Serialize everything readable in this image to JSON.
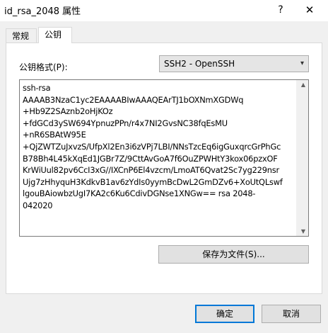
{
  "window": {
    "title": "id_rsa_2048 属性",
    "help_glyph": "?",
    "close_glyph": "✕"
  },
  "tabs": [
    {
      "label": "常规",
      "active": false
    },
    {
      "label": "公钥",
      "active": true
    }
  ],
  "format": {
    "label": "公钥格式(P):",
    "selected": "SSH2 - OpenSSH"
  },
  "key_text": "ssh-rsa\nAAAAB3NzaC1yc2EAAAABIwAAAQEArTJ1bOXNmXGDWq\n+Hb9Z2SAznb2oHjKOz\n+fdGCd3ySW694YpnuzPPn/r4x7NI2GvsNC38fqEsMU\n+nR6SBAtW95E\n+QjZWTZuJxvzS/UfpXl2En3i6zVPj7LBI/NNsTzcEq6igGuxqrcGrPhGc\nB78Bh4L45kXqEd1JGBr7Z/9CttAvGoA7f6OuZPWHtY3kox06pzxOF\nKrWiUul82pv6CcI3xG//IXCnP6El4vzcm/LmoAT6Qvat2Sc7yg229nsr\nUjg7zHhyquH3KdkvB1av6zYdIs0yymBcDwL2GmDZv6+XoUtQLswf\nlgouBAiowbzUgI7KA2c6Ku6CdivDGNse1XNGw== rsa 2048-\n042020",
  "buttons": {
    "save": "保存为文件(S)...",
    "ok": "确定",
    "cancel": "取消"
  },
  "icons": {
    "dropdown": "▾",
    "scroll_up": "▲",
    "scroll_down": "▼"
  }
}
